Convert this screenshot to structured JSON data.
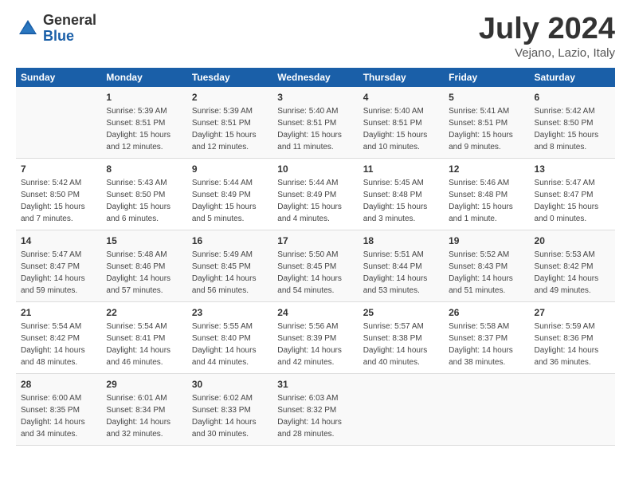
{
  "logo": {
    "general": "General",
    "blue": "Blue"
  },
  "title": "July 2024",
  "subtitle": "Vejano, Lazio, Italy",
  "days_of_week": [
    "Sunday",
    "Monday",
    "Tuesday",
    "Wednesday",
    "Thursday",
    "Friday",
    "Saturday"
  ],
  "weeks": [
    [
      {
        "day": "",
        "info": ""
      },
      {
        "day": "1",
        "info": "Sunrise: 5:39 AM\nSunset: 8:51 PM\nDaylight: 15 hours\nand 12 minutes."
      },
      {
        "day": "2",
        "info": "Sunrise: 5:39 AM\nSunset: 8:51 PM\nDaylight: 15 hours\nand 12 minutes."
      },
      {
        "day": "3",
        "info": "Sunrise: 5:40 AM\nSunset: 8:51 PM\nDaylight: 15 hours\nand 11 minutes."
      },
      {
        "day": "4",
        "info": "Sunrise: 5:40 AM\nSunset: 8:51 PM\nDaylight: 15 hours\nand 10 minutes."
      },
      {
        "day": "5",
        "info": "Sunrise: 5:41 AM\nSunset: 8:51 PM\nDaylight: 15 hours\nand 9 minutes."
      },
      {
        "day": "6",
        "info": "Sunrise: 5:42 AM\nSunset: 8:50 PM\nDaylight: 15 hours\nand 8 minutes."
      }
    ],
    [
      {
        "day": "7",
        "info": "Sunrise: 5:42 AM\nSunset: 8:50 PM\nDaylight: 15 hours\nand 7 minutes."
      },
      {
        "day": "8",
        "info": "Sunrise: 5:43 AM\nSunset: 8:50 PM\nDaylight: 15 hours\nand 6 minutes."
      },
      {
        "day": "9",
        "info": "Sunrise: 5:44 AM\nSunset: 8:49 PM\nDaylight: 15 hours\nand 5 minutes."
      },
      {
        "day": "10",
        "info": "Sunrise: 5:44 AM\nSunset: 8:49 PM\nDaylight: 15 hours\nand 4 minutes."
      },
      {
        "day": "11",
        "info": "Sunrise: 5:45 AM\nSunset: 8:48 PM\nDaylight: 15 hours\nand 3 minutes."
      },
      {
        "day": "12",
        "info": "Sunrise: 5:46 AM\nSunset: 8:48 PM\nDaylight: 15 hours\nand 1 minute."
      },
      {
        "day": "13",
        "info": "Sunrise: 5:47 AM\nSunset: 8:47 PM\nDaylight: 15 hours\nand 0 minutes."
      }
    ],
    [
      {
        "day": "14",
        "info": "Sunrise: 5:47 AM\nSunset: 8:47 PM\nDaylight: 14 hours\nand 59 minutes."
      },
      {
        "day": "15",
        "info": "Sunrise: 5:48 AM\nSunset: 8:46 PM\nDaylight: 14 hours\nand 57 minutes."
      },
      {
        "day": "16",
        "info": "Sunrise: 5:49 AM\nSunset: 8:45 PM\nDaylight: 14 hours\nand 56 minutes."
      },
      {
        "day": "17",
        "info": "Sunrise: 5:50 AM\nSunset: 8:45 PM\nDaylight: 14 hours\nand 54 minutes."
      },
      {
        "day": "18",
        "info": "Sunrise: 5:51 AM\nSunset: 8:44 PM\nDaylight: 14 hours\nand 53 minutes."
      },
      {
        "day": "19",
        "info": "Sunrise: 5:52 AM\nSunset: 8:43 PM\nDaylight: 14 hours\nand 51 minutes."
      },
      {
        "day": "20",
        "info": "Sunrise: 5:53 AM\nSunset: 8:42 PM\nDaylight: 14 hours\nand 49 minutes."
      }
    ],
    [
      {
        "day": "21",
        "info": "Sunrise: 5:54 AM\nSunset: 8:42 PM\nDaylight: 14 hours\nand 48 minutes."
      },
      {
        "day": "22",
        "info": "Sunrise: 5:54 AM\nSunset: 8:41 PM\nDaylight: 14 hours\nand 46 minutes."
      },
      {
        "day": "23",
        "info": "Sunrise: 5:55 AM\nSunset: 8:40 PM\nDaylight: 14 hours\nand 44 minutes."
      },
      {
        "day": "24",
        "info": "Sunrise: 5:56 AM\nSunset: 8:39 PM\nDaylight: 14 hours\nand 42 minutes."
      },
      {
        "day": "25",
        "info": "Sunrise: 5:57 AM\nSunset: 8:38 PM\nDaylight: 14 hours\nand 40 minutes."
      },
      {
        "day": "26",
        "info": "Sunrise: 5:58 AM\nSunset: 8:37 PM\nDaylight: 14 hours\nand 38 minutes."
      },
      {
        "day": "27",
        "info": "Sunrise: 5:59 AM\nSunset: 8:36 PM\nDaylight: 14 hours\nand 36 minutes."
      }
    ],
    [
      {
        "day": "28",
        "info": "Sunrise: 6:00 AM\nSunset: 8:35 PM\nDaylight: 14 hours\nand 34 minutes."
      },
      {
        "day": "29",
        "info": "Sunrise: 6:01 AM\nSunset: 8:34 PM\nDaylight: 14 hours\nand 32 minutes."
      },
      {
        "day": "30",
        "info": "Sunrise: 6:02 AM\nSunset: 8:33 PM\nDaylight: 14 hours\nand 30 minutes."
      },
      {
        "day": "31",
        "info": "Sunrise: 6:03 AM\nSunset: 8:32 PM\nDaylight: 14 hours\nand 28 minutes."
      },
      {
        "day": "",
        "info": ""
      },
      {
        "day": "",
        "info": ""
      },
      {
        "day": "",
        "info": ""
      }
    ]
  ]
}
